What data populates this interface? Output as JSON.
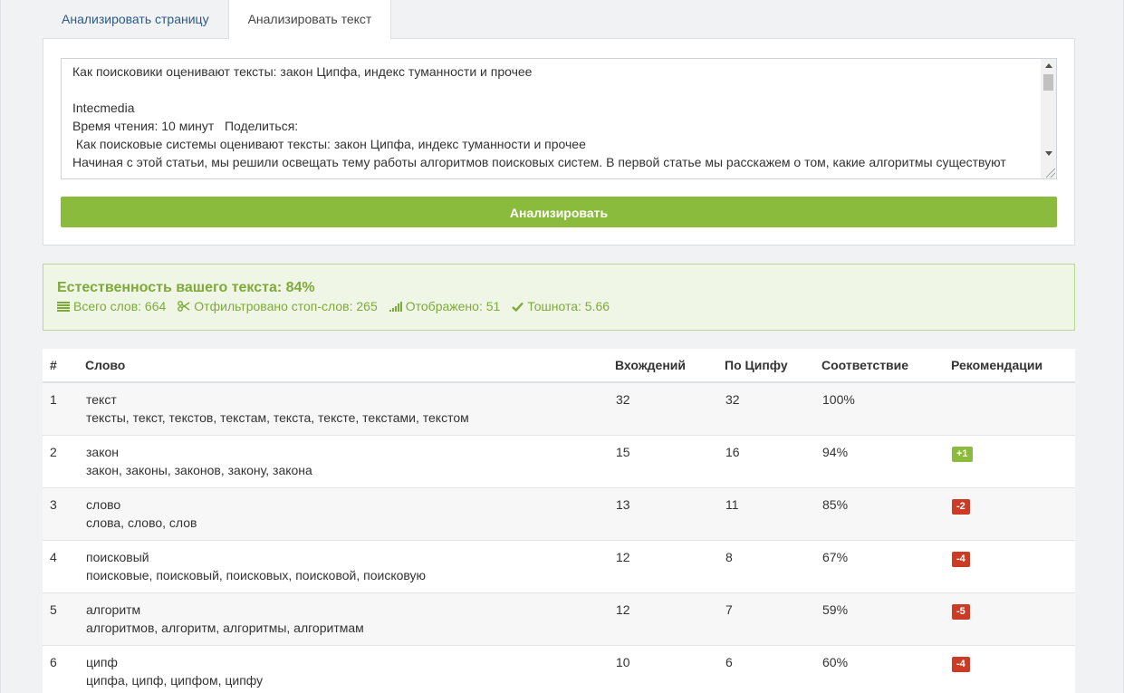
{
  "tabs": {
    "analyze_page": "Анализировать страницу",
    "analyze_text": "Анализировать текст"
  },
  "form": {
    "text_lines": [
      "Как поисковики оценивают тексты: закон Ципфа, индекс туманности и прочее",
      "",
      "Intecmedia",
      "Время чтения: 10 минут   Поделиться:",
      " Как поисковые системы оценивают тексты: закон Ципфа, индекс туманности и прочее",
      "Начиная с этой статьи, мы решили освещать тему работы алгоритмов поисковых систем. В первой статье мы расскажем о том, какие алгоритмы существуют"
    ],
    "analyze_button": "Анализировать"
  },
  "result": {
    "title": "Естественность вашего текста: 84%",
    "total_words": "Всего слов: 664",
    "filtered_stopwords": "Отфильтровано стоп-слов: 265",
    "displayed": "Отображено: 51",
    "nausea": "Тошнота: 5.66"
  },
  "table": {
    "headers": [
      "#",
      "Слово",
      "Вхождений",
      "По Ципфу",
      "Соответствие",
      "Рекомендации"
    ],
    "rows": [
      {
        "n": "1",
        "word": "текст",
        "forms": "тексты, текст, текстов, текстам, текста, тексте, текстами, текстом",
        "occurrences": "32",
        "zipf": "32",
        "match": "100%",
        "rec": "",
        "rec_type": ""
      },
      {
        "n": "2",
        "word": "закон",
        "forms": "закон, законы, законов, закону, закона",
        "occurrences": "15",
        "zipf": "16",
        "match": "94%",
        "rec": "+1",
        "rec_type": "plus"
      },
      {
        "n": "3",
        "word": "слово",
        "forms": "слова, слово, слов",
        "occurrences": "13",
        "zipf": "11",
        "match": "85%",
        "rec": "-2",
        "rec_type": "minus"
      },
      {
        "n": "4",
        "word": "поисковый",
        "forms": "поисковые, поисковый, поисковых, поисковой, поисковую",
        "occurrences": "12",
        "zipf": "8",
        "match": "67%",
        "rec": "-4",
        "rec_type": "minus"
      },
      {
        "n": "5",
        "word": "алгоритм",
        "forms": "алгоритмов, алгоритм, алгоритмы, алгоритмам",
        "occurrences": "12",
        "zipf": "7",
        "match": "59%",
        "rec": "-5",
        "rec_type": "minus"
      },
      {
        "n": "6",
        "word": "ципф",
        "forms": "ципфа, ципф, ципфом, ципфу",
        "occurrences": "10",
        "zipf": "6",
        "match": "60%",
        "rec": "-4",
        "rec_type": "minus"
      }
    ]
  },
  "colors": {
    "accent_green": "#8bbb3c",
    "badge_red": "#cc3b25",
    "result_text": "#7ea93a"
  }
}
